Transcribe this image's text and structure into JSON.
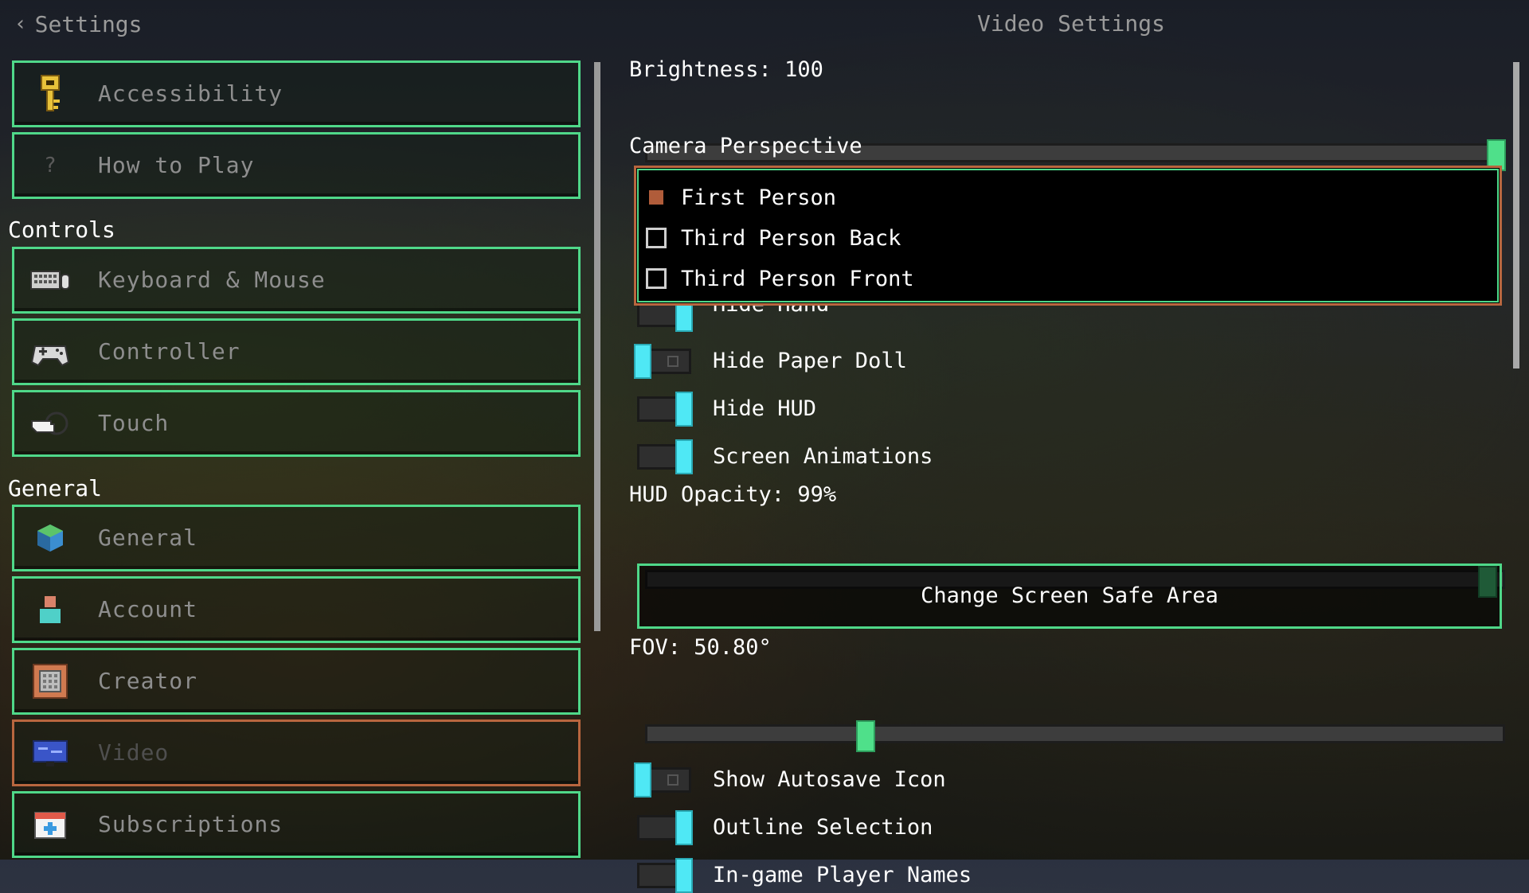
{
  "header": {
    "back_label": "Settings",
    "title": "Video Settings"
  },
  "sidebar": {
    "top_items": [
      {
        "label": "Accessibility",
        "icon": "key-icon"
      },
      {
        "label": "How to Play",
        "icon": "question-icon"
      }
    ],
    "sections": [
      {
        "title": "Controls",
        "items": [
          {
            "label": "Keyboard & Mouse",
            "icon": "keyboard-icon"
          },
          {
            "label": "Controller",
            "icon": "gamepad-icon"
          },
          {
            "label": "Touch",
            "icon": "pointing-hand-icon"
          }
        ]
      },
      {
        "title": "General",
        "items": [
          {
            "label": "General",
            "icon": "cube-icon"
          },
          {
            "label": "Account",
            "icon": "user-icon"
          },
          {
            "label": "Creator",
            "icon": "creator-icon"
          },
          {
            "label": "Video",
            "icon": "monitor-icon",
            "active": true
          },
          {
            "label": "Subscriptions",
            "icon": "calendar-plus-icon"
          }
        ]
      }
    ]
  },
  "settings": {
    "brightness": {
      "label": "Brightness: 100",
      "value": 100,
      "max": 100
    },
    "camera": {
      "label": "Camera Perspective",
      "options": [
        "First Person",
        "Third Person Back",
        "Third Person Front"
      ],
      "selected": 0
    },
    "toggles_top": [
      {
        "label": "Hide Hand",
        "on": true
      },
      {
        "label": "Hide Paper Doll",
        "on": false
      },
      {
        "label": "Hide HUD",
        "on": true
      },
      {
        "label": "Screen Animations",
        "on": true
      }
    ],
    "hud_opacity": {
      "label": "HUD Opacity: 99%",
      "value": 99,
      "max": 100
    },
    "safe_area_button": "Change Screen Safe Area",
    "fov": {
      "label": "FOV: 50.80°",
      "value": 0.26
    },
    "toggles_bottom": [
      {
        "label": "Show Autosave Icon",
        "on": false
      },
      {
        "label": "Outline Selection",
        "on": true
      },
      {
        "label": "In-game Player Names",
        "on": true
      }
    ]
  },
  "colors": {
    "accent_green": "#4fd889",
    "active_orange": "#b8663f",
    "toggle_cyan": "#4fe8f5"
  }
}
